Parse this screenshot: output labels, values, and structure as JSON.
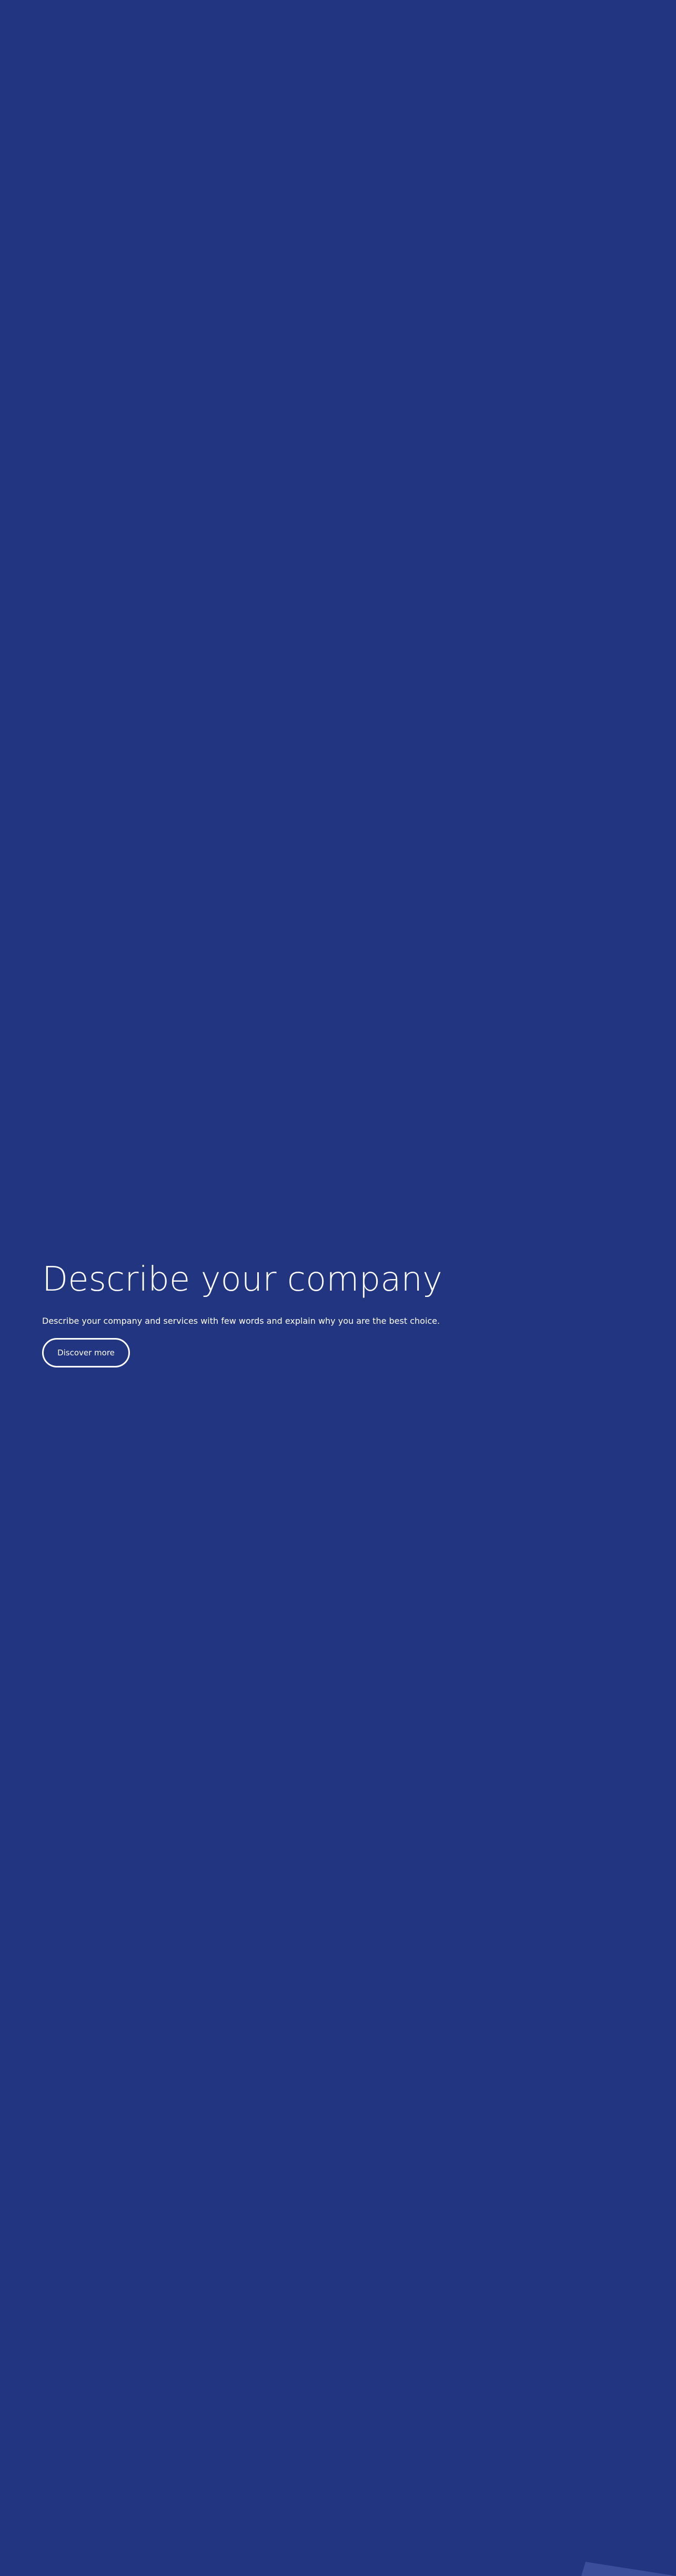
{
  "hero": {
    "title": "Describe your company",
    "description": "Describe your company and services with few words and explain why you are the best choice.",
    "button_label": "Discover more"
  },
  "colors": {
    "background": "#223581",
    "text": "#ffffff",
    "accent_shape": "#3a4e9b"
  }
}
